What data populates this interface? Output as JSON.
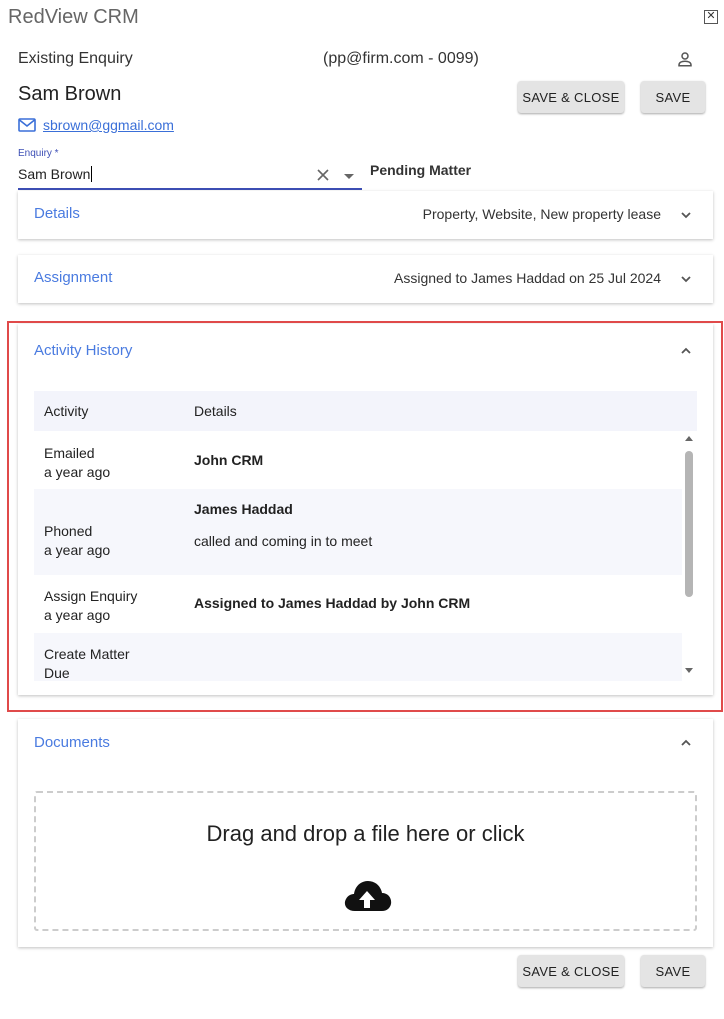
{
  "window": {
    "title": "RedView CRM",
    "close_glyph": "✕"
  },
  "header": {
    "enquiry_type": "Existing Enquiry",
    "enquiry_id": "(pp@firm.com - 0099)",
    "person_icon": "person-icon",
    "contact_name": "Sam Brown",
    "email": "sbrown@ggmail.com",
    "email_icon": "mail-icon"
  },
  "actions": {
    "save_close_label": "SAVE & CLOSE",
    "save_label": "SAVE"
  },
  "enquiry_field": {
    "label": "Enquiry *",
    "value": "Sam Brown",
    "status": "Pending Matter"
  },
  "panels": {
    "details": {
      "title": "Details",
      "summary": "Property, Website, New property lease",
      "expanded": false
    },
    "assignment": {
      "title": "Assignment",
      "summary": "Assigned to James Haddad on 25 Jul 2024",
      "expanded": false
    },
    "activity_history": {
      "title": "Activity History",
      "expanded": true,
      "columns": [
        "Activity",
        "Details"
      ],
      "rows": [
        {
          "activity": "Emailed",
          "when": "a year ago",
          "detail_title": "John CRM",
          "detail_text": ""
        },
        {
          "activity": "Phoned",
          "when": "a year ago",
          "detail_title": "James Haddad",
          "detail_text": "called and coming in to meet"
        },
        {
          "activity": "Assign Enquiry",
          "when": "a year ago",
          "detail_title": "Assigned to James Haddad by John CRM",
          "detail_text": ""
        },
        {
          "activity": "Create Matter",
          "when": "Due",
          "detail_title": "",
          "detail_text": ""
        }
      ]
    },
    "documents": {
      "title": "Documents",
      "expanded": true,
      "dropzone_text": "Drag and drop a file here or click",
      "upload_icon": "cloud-upload-icon"
    }
  },
  "colors": {
    "accent": "#4a7be0",
    "input_underline": "#3d4fb5",
    "highlight_border": "#e04a4a",
    "button_bg": "#e4e4e4",
    "row_alt_bg": "#f6f7fc"
  }
}
